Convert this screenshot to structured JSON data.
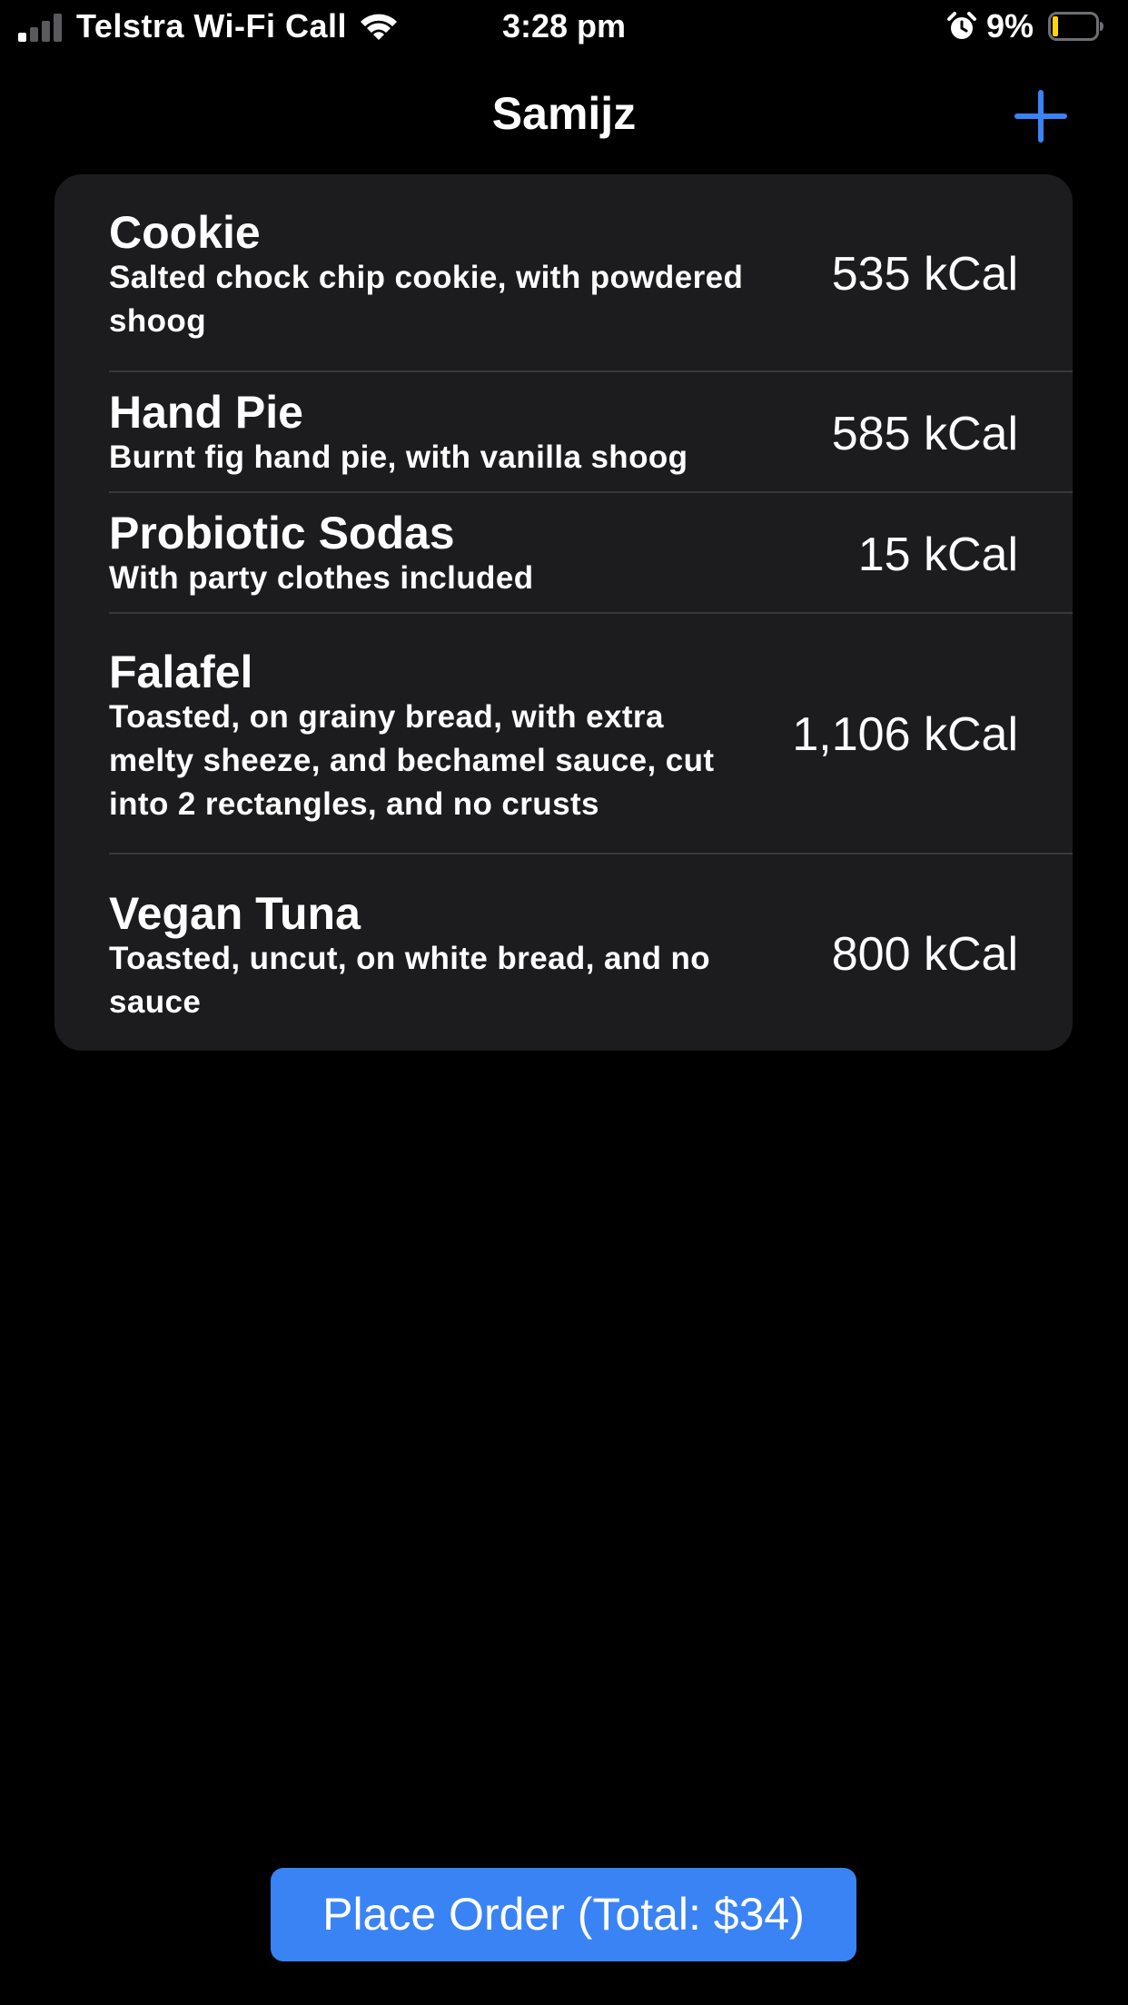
{
  "status_bar": {
    "carrier": "Telstra Wi-Fi Call",
    "time": "3:28 pm",
    "battery_percent": "9%",
    "battery_level": 0.09,
    "battery_color": "#ffd60a",
    "signal_bars_active": 1,
    "icons": [
      "signal-bars-icon",
      "wifi-icon",
      "alarm-clock-icon",
      "battery-icon"
    ]
  },
  "nav": {
    "title": "Samijz",
    "add_icon": "plus-icon",
    "accent_color": "#3a83f5"
  },
  "items": [
    {
      "name": "Cookie",
      "description": "Salted chock chip cookie, with powdered shoog",
      "kcal": "535 kCal"
    },
    {
      "name": "Hand Pie",
      "description": "Burnt fig hand pie, with vanilla shoog",
      "kcal": "585 kCal"
    },
    {
      "name": "Probiotic Sodas",
      "description": "With party clothes included",
      "kcal": "15 kCal"
    },
    {
      "name": "Falafel",
      "description": "Toasted, on grainy bread, with extra melty sheeze, and bechamel sauce, cut into 2 rectangles, and no crusts",
      "kcal": "1,106 kCal"
    },
    {
      "name": "Vegan Tuna",
      "description": "Toasted, uncut, on white bread, and no sauce",
      "kcal": "800 kCal"
    }
  ],
  "order_button": {
    "label": "Place Order (Total: $34)"
  }
}
